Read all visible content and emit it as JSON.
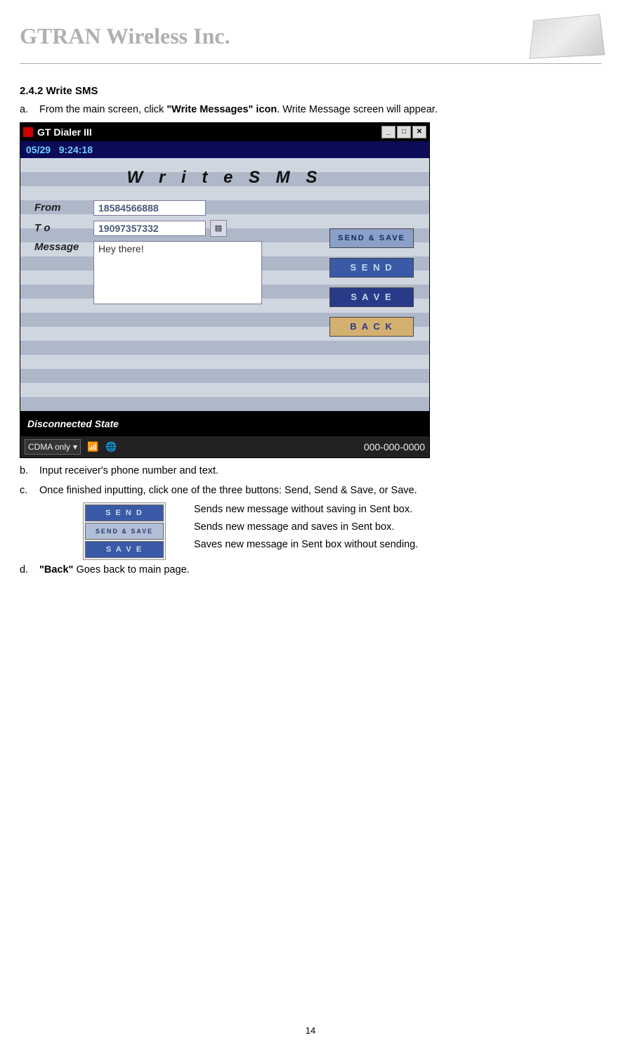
{
  "header": {
    "company": "GTRAN Wireless Inc."
  },
  "section": {
    "number": "2.4.2",
    "title": "Write SMS"
  },
  "steps": {
    "a_pre": "From the main screen, click ",
    "a_bold": "\"Write Messages\" icon",
    "a_post": ". Write Message screen will appear.",
    "b": "Input receiver's phone number and text.",
    "c": "Once finished inputting, click one of the three buttons: Send, Send & Save, or Save.",
    "d_bold": "\"Back\"",
    "d_post": " Goes back to main page."
  },
  "button_desc": {
    "send": "Sends new message without saving in Sent box.",
    "sendsave": "Sends new message and saves in Sent box.",
    "save": "Saves new message in Sent box without sending."
  },
  "app": {
    "title": "GT Dialer III",
    "date": "05/29",
    "time": "9:24:18",
    "screen_title": "W r i t e S M S",
    "labels": {
      "from": "From",
      "to": "T o",
      "message": "Message"
    },
    "fields": {
      "from": "18584566888",
      "to": "19097357332",
      "message": "Hey there!"
    },
    "buttons": {
      "sendsave": "SEND & SAVE",
      "send": "S E N D",
      "save": "S A V E",
      "back": "B A C K"
    },
    "status": "Disconnected State",
    "mode": "CDMA only",
    "phone": "000-000-0000"
  },
  "mini_buttons": {
    "send": "S E N D",
    "sendsave": "SEND & SAVE",
    "save": "S A V E"
  },
  "page_number": "14"
}
